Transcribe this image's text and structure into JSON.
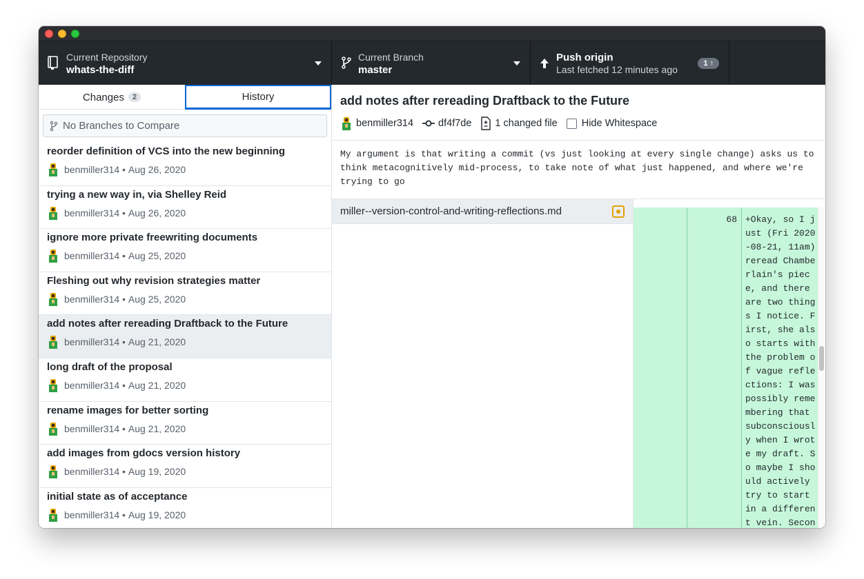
{
  "toolbar": {
    "repo_label": "Current Repository",
    "repo_name": "whats-the-diff",
    "branch_label": "Current Branch",
    "branch_name": "master",
    "push_title": "Push origin",
    "push_subtitle": "Last fetched 12 minutes ago",
    "push_count": "1 ↑"
  },
  "sidebar": {
    "tabs": [
      {
        "label": "Changes",
        "count": "2"
      },
      {
        "label": "History"
      }
    ],
    "compare_placeholder": "No Branches to Compare",
    "commits": [
      {
        "summary": "reorder definition of VCS into the new beginning",
        "author": "benmiller314",
        "date": "Aug 26, 2020"
      },
      {
        "summary": "trying a new way in, via Shelley Reid",
        "author": "benmiller314",
        "date": "Aug 26, 2020"
      },
      {
        "summary": "ignore more private freewriting documents",
        "author": "benmiller314",
        "date": "Aug 25, 2020"
      },
      {
        "summary": "Fleshing out why revision strategies matter",
        "author": "benmiller314",
        "date": "Aug 25, 2020"
      },
      {
        "summary": "add notes after rereading Draftback to the Future",
        "author": "benmiller314",
        "date": "Aug 21, 2020"
      },
      {
        "summary": "long draft of the proposal",
        "author": "benmiller314",
        "date": "Aug 21, 2020"
      },
      {
        "summary": "rename images for better sorting",
        "author": "benmiller314",
        "date": "Aug 21, 2020"
      },
      {
        "summary": "add images from gdocs version history",
        "author": "benmiller314",
        "date": "Aug 19, 2020"
      },
      {
        "summary": "initial state as of acceptance",
        "author": "benmiller314",
        "date": "Aug 19, 2020"
      }
    ]
  },
  "detail": {
    "title": "add notes after rereading Draftback to the Future",
    "author": "benmiller314",
    "sha": "df4f7de",
    "changed_files": "1 changed file",
    "hide_whitespace_label": "Hide Whitespace",
    "description": "My argument is that writing a commit (vs just looking at every single change) asks us to think metacognitively mid-process, to take note of what just happened, and where we're trying to go",
    "file_name": "miller--version-control-and-writing-reflections.md",
    "diff_line_number": "68",
    "diff_text": "+Okay, so I j\nust (Fri 2020\n-08-21, 11am)\nreread Chambe\nrlain's piec\ne, and there\nare two thing\ns I notice. F\nirst, she als\no starts with\nthe problem o\nf vague refle\nctions: I was\npossibly reme\nmbering that\nsubconsciousl\ny when I wrot\ne my draft. S\no maybe I sho\nuld actively\ntry to start\nin a differen\nt vein. Secon"
  },
  "colors": {
    "toolbar_bg": "#24292e",
    "selection_blue": "#0366d6",
    "diff_added_bg": "#c6f7da",
    "modified_icon": "#e3a008"
  }
}
